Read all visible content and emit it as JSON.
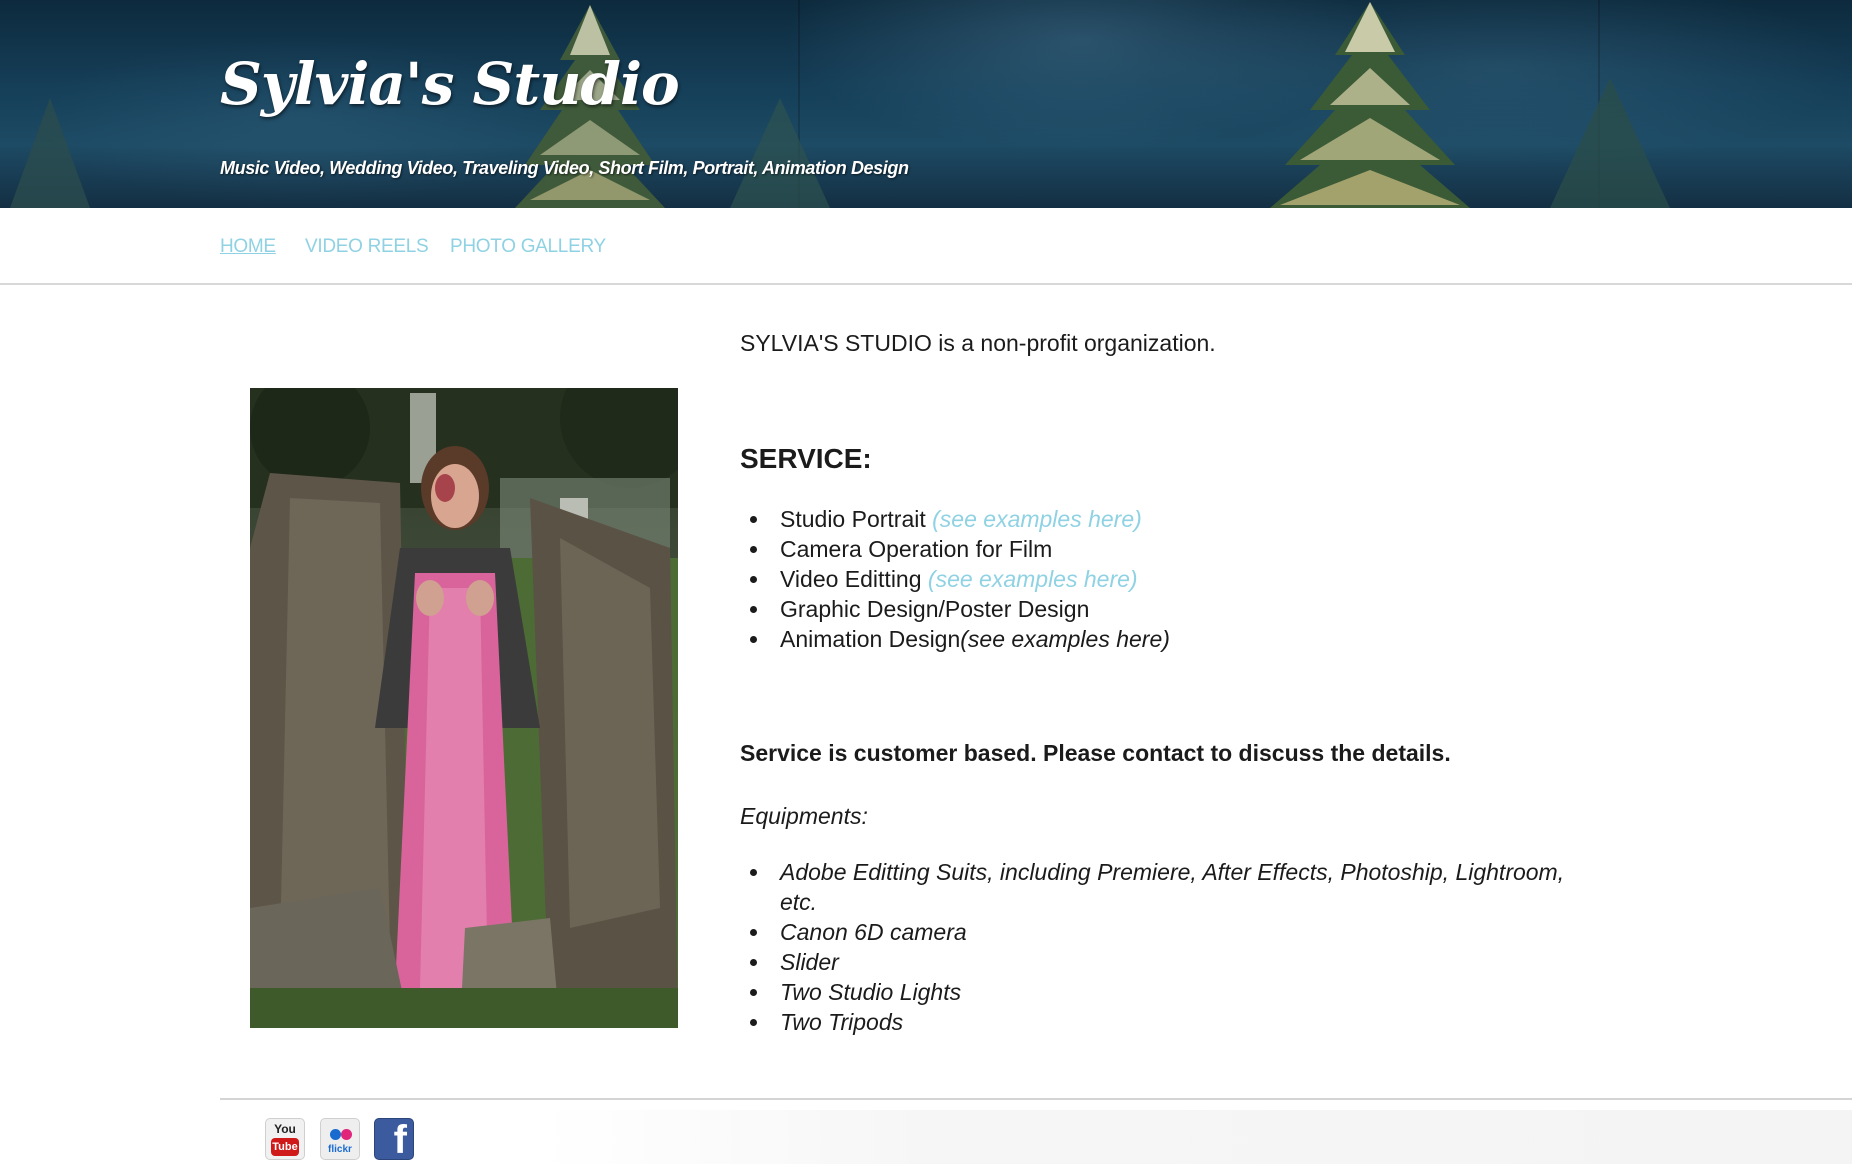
{
  "header": {
    "site_title": "Sylvia's Studio",
    "tagline": "Music Video, Wedding Video, Traveling Video, Short Film, Portrait, Animation Design"
  },
  "nav": {
    "items": [
      {
        "label": "HOME",
        "active": true
      },
      {
        "label": "VIDEO REELS",
        "active": false
      },
      {
        "label": "PHOTO GALLERY",
        "active": false
      }
    ]
  },
  "main": {
    "intro": "SYLVIA'S STUDIO is a non-profit organization.",
    "service_heading": "SERVICE:",
    "services": [
      {
        "text": "Studio Portrait ",
        "example": "(see examples here)",
        "example_linked": true
      },
      {
        "text": "Camera Operation for Film",
        "example": "",
        "example_linked": false
      },
      {
        "text": "Video Editting ",
        "example": "(see examples here)",
        "example_linked": true
      },
      {
        "text": "Graphic Design/Poster Design",
        "example": "",
        "example_linked": false
      },
      {
        "text": "Animation Design",
        "example": "(see examples here)",
        "example_linked": false
      }
    ],
    "note": "Service is customer based. Please contact to discuss the details.",
    "equipment_heading": "Equipments:",
    "equipment": [
      "Adobe Editting Suits, including Premiere, After Effects, Photoship, Lightroom,",
      "etc.",
      "Canon 6D camera",
      "Slider",
      "Two Studio Lights",
      "Two Tripods"
    ]
  },
  "footer": {
    "social": [
      {
        "name": "youtube",
        "line1": "You",
        "line2": "Tube"
      },
      {
        "name": "flickr",
        "word": "flickr"
      },
      {
        "name": "facebook",
        "glyph": "f"
      }
    ]
  },
  "colors": {
    "link": "#8fd2e3",
    "banner_dark": "#0d2a3d",
    "text": "#1b1b1b"
  }
}
